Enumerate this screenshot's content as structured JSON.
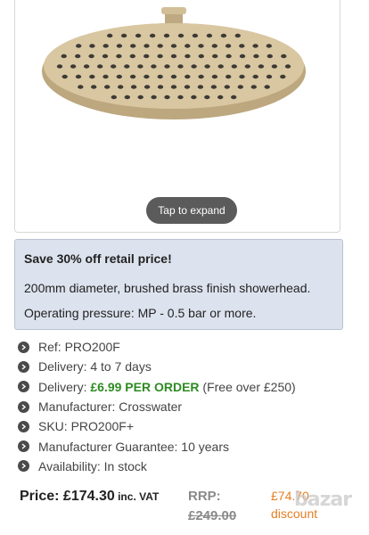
{
  "image_card": {
    "expand_label": "Tap to expand"
  },
  "promo": {
    "title": "Save 30% off retail price!",
    "line1": "200mm diameter, brushed brass finish showerhead.",
    "line2": "Operating pressure: MP - 0.5 bar or more."
  },
  "details": {
    "ref": "Ref: PRO200F",
    "delivery1": "Delivery: 4 to 7 days",
    "delivery2_prefix": "Delivery: ",
    "delivery2_highlight": "£6.99 PER ORDER",
    "delivery2_suffix": " (Free over £250)",
    "manufacturer": "Manufacturer: Crosswater",
    "sku": "SKU: PRO200F+",
    "guarantee": "Manufacturer Guarantee: 10 years",
    "availability": "Availability: In stock"
  },
  "pricing": {
    "price_label": "Price: ",
    "price_value": "£174.30",
    "price_vat": " inc. VAT",
    "rrp_label": "RRP:",
    "rrp_value": "£249.00",
    "saving_value": "£74.70",
    "saving_label": "discount"
  },
  "watermark": "bazar",
  "icons": {
    "bullet": "chevron-right-circle-icon"
  },
  "colors": {
    "promo_bg": "#dde3ee",
    "green": "#2e8b22",
    "orange": "#e67e22",
    "brass": "#c9b48a"
  }
}
